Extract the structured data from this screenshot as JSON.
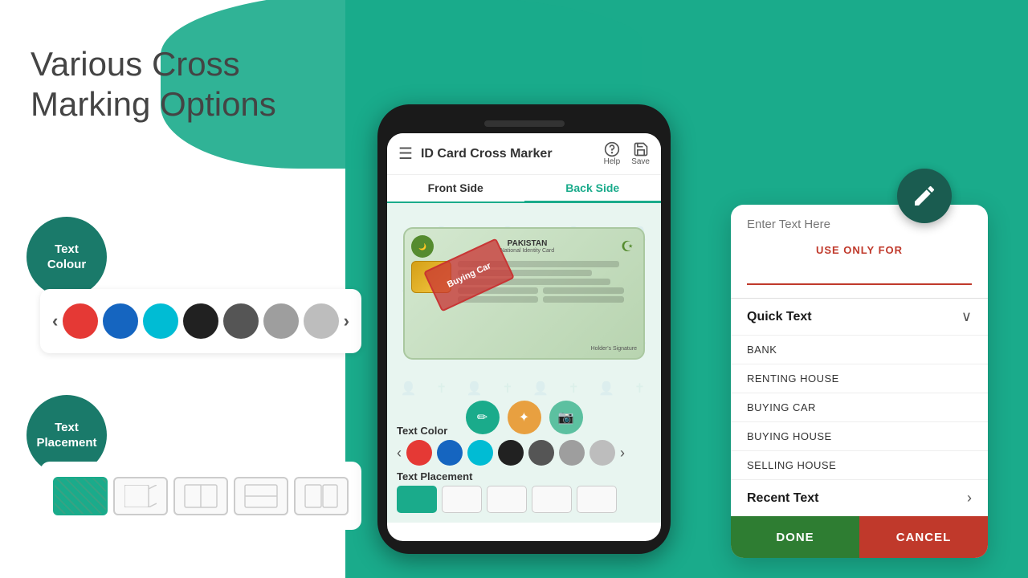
{
  "background": {
    "white_width": 430,
    "teal_color": "#1aab8b"
  },
  "heading": {
    "line1": "Various Cross",
    "line2": "Marking Options"
  },
  "text_colour": {
    "label": "Text\nColour",
    "colors": [
      "#e53935",
      "#1565c0",
      "#00bcd4",
      "#212121",
      "#555555",
      "#9e9e9e",
      "#bdbdbd"
    ]
  },
  "text_placement": {
    "label": "Text\nPlacement"
  },
  "app_bar": {
    "title": "ID Card Cross Marker",
    "help_label": "Help",
    "save_label": "Save"
  },
  "tabs": {
    "front": "Front Side",
    "back": "Back Side"
  },
  "id_card": {
    "country": "PAKISTAN",
    "subtitle": "National Identity Card",
    "stamp_text": "Buying Car"
  },
  "phone_bottom": {
    "color_label": "Text Color",
    "placement_label": "Text Placement",
    "colors": [
      "#e53935",
      "#1565c0",
      "#00bcd4",
      "#212121",
      "#555555",
      "#9e9e9e",
      "#bdbdbd"
    ]
  },
  "dialog": {
    "placeholder": "Enter Text Here",
    "subtitle": "USE ONLY FOR",
    "quick_text_label": "Quick Text",
    "quick_text_items": [
      "BANK",
      "RENTING HOUSE",
      "BUYING CAR",
      "BUYING HOUSE",
      "SELLING HOUSE"
    ],
    "recent_text_label": "Recent Text",
    "done_label": "DONE",
    "cancel_label": "CANCEL"
  },
  "edit_fab": {
    "icon": "✏"
  }
}
